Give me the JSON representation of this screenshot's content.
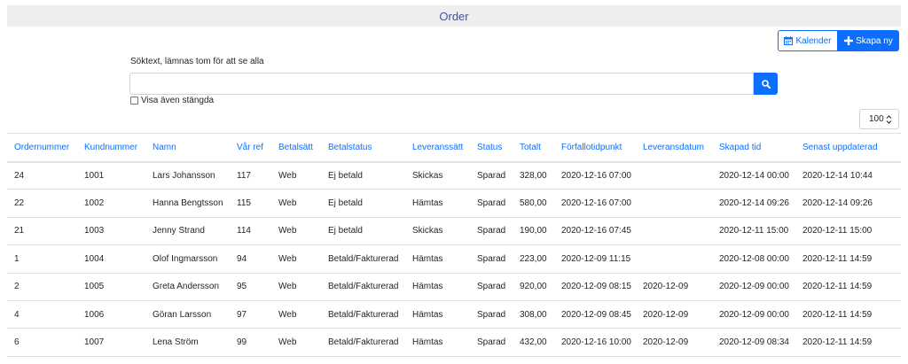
{
  "header": {
    "title": "Order"
  },
  "toolbar": {
    "calendar_label": "Kalender",
    "new_label": "Skapa ny"
  },
  "search": {
    "label": "Söktext, lämnas tom för att se alla",
    "value": "",
    "checkbox_label": "Visa även stängda",
    "checkbox_checked": false
  },
  "pagesize": {
    "selected": "100"
  },
  "colors": {
    "accent": "#0d6efd",
    "title_text": "#4a4f9e",
    "title_bg": "#eeeeee"
  },
  "icons": {
    "calendar": "calendar-icon",
    "plus": "plus-icon",
    "search": "search-icon",
    "chevron": "chevron-down-icon"
  },
  "table": {
    "columns": [
      "Ordernummer",
      "Kundnummer",
      "Namn",
      "Vår ref",
      "Betalsätt",
      "Betalstatus",
      "Leveranssätt",
      "Status",
      "Totalt",
      "Förfallotidpunkt",
      "Leveransdatum",
      "Skapad tid",
      "Senast uppdaterad"
    ],
    "rows": [
      [
        "24",
        "1001",
        "Lars Johansson",
        "117",
        "Web",
        "Ej betald",
        "Skickas",
        "Sparad",
        "328,00",
        "2020-12-16 07:00",
        "",
        "2020-12-14 00:00",
        "2020-12-14 10:44"
      ],
      [
        "22",
        "1002",
        "Hanna Bengtsson",
        "115",
        "Web",
        "Ej betald",
        "Hämtas",
        "Sparad",
        "580,00",
        "2020-12-16 07:00",
        "",
        "2020-12-14 09:26",
        "2020-12-14 09:26"
      ],
      [
        "21",
        "1003",
        "Jenny Strand",
        "114",
        "Web",
        "Ej betald",
        "Skickas",
        "Sparad",
        "190,00",
        "2020-12-16 07:45",
        "",
        "2020-12-11 15:00",
        "2020-12-11 15:00"
      ],
      [
        "1",
        "1004",
        "Olof Ingmarsson",
        "94",
        "Web",
        "Betald/Fakturerad",
        "Hämtas",
        "Sparad",
        "223,00",
        "2020-12-09 11:15",
        "",
        "2020-12-08 00:00",
        "2020-12-11 14:59"
      ],
      [
        "2",
        "1005",
        "Greta Andersson",
        "95",
        "Web",
        "Betald/Fakturerad",
        "Hämtas",
        "Sparad",
        "920,00",
        "2020-12-09 08:15",
        "2020-12-09",
        "2020-12-09 00:00",
        "2020-12-11 14:59"
      ],
      [
        "4",
        "1006",
        "Göran Larsson",
        "97",
        "Web",
        "Betald/Fakturerad",
        "Hämtas",
        "Sparad",
        "308,00",
        "2020-12-09 08:45",
        "2020-12-09",
        "2020-12-09 00:00",
        "2020-12-11 14:59"
      ],
      [
        "6",
        "1007",
        "Lena Ström",
        "99",
        "Web",
        "Betald/Fakturerad",
        "Hämtas",
        "Sparad",
        "432,00",
        "2020-12-16 10:00",
        "2020-12-09",
        "2020-12-09 08:34",
        "2020-12-11 14:59"
      ]
    ]
  }
}
